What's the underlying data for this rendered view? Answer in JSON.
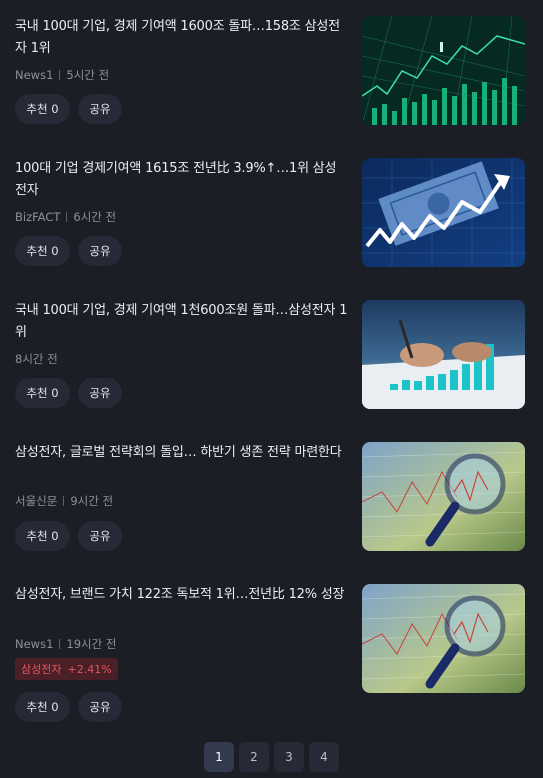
{
  "articles": [
    {
      "title": "국내 100대 기업, 경제 기여액 1600조 돌파…158조 삼성전자 1위",
      "source": "News1",
      "time": "5시간 전",
      "recommend_label": "추천 0",
      "share_label": "공유",
      "thumbnail": "stock-market-chart"
    },
    {
      "title": "100대 기업 경제기여액 1615조 전년比 3.9%↑…1위 삼성전자",
      "source": "BizFACT",
      "time": "6시간 전",
      "recommend_label": "추천 0",
      "share_label": "공유",
      "thumbnail": "money-arrow-growth"
    },
    {
      "title": "국내 100대 기업, 경제 기여액 1천600조원 돌파…삼성전자 1위",
      "source": "",
      "time": "8시간 전",
      "recommend_label": "추천 0",
      "share_label": "공유",
      "thumbnail": "hand-writing-bar-chart"
    },
    {
      "title": "삼성전자, 글로벌 전략회의 돌입… 하반기 생존 전략 마련한다",
      "source": "서울신문",
      "time": "9시간 전",
      "recommend_label": "추천 0",
      "share_label": "공유",
      "thumbnail": "magnifying-glass-chart"
    },
    {
      "title": "삼성전자, 브랜드 가치 122조 독보적 1위…전년比 12% 성장",
      "source": "News1",
      "time": "19시간 전",
      "stock_name": "삼성전자",
      "stock_change": "+2.41%",
      "recommend_label": "추천 0",
      "share_label": "공유",
      "thumbnail": "magnifying-glass-chart"
    }
  ],
  "pagination": {
    "pages": [
      "1",
      "2",
      "3",
      "4"
    ],
    "current": "1"
  },
  "colors": {
    "background": "#1c1e26",
    "button_bg": "#262a37",
    "stock_up": "#e0575f",
    "stock_bg": "#4a1f26"
  }
}
